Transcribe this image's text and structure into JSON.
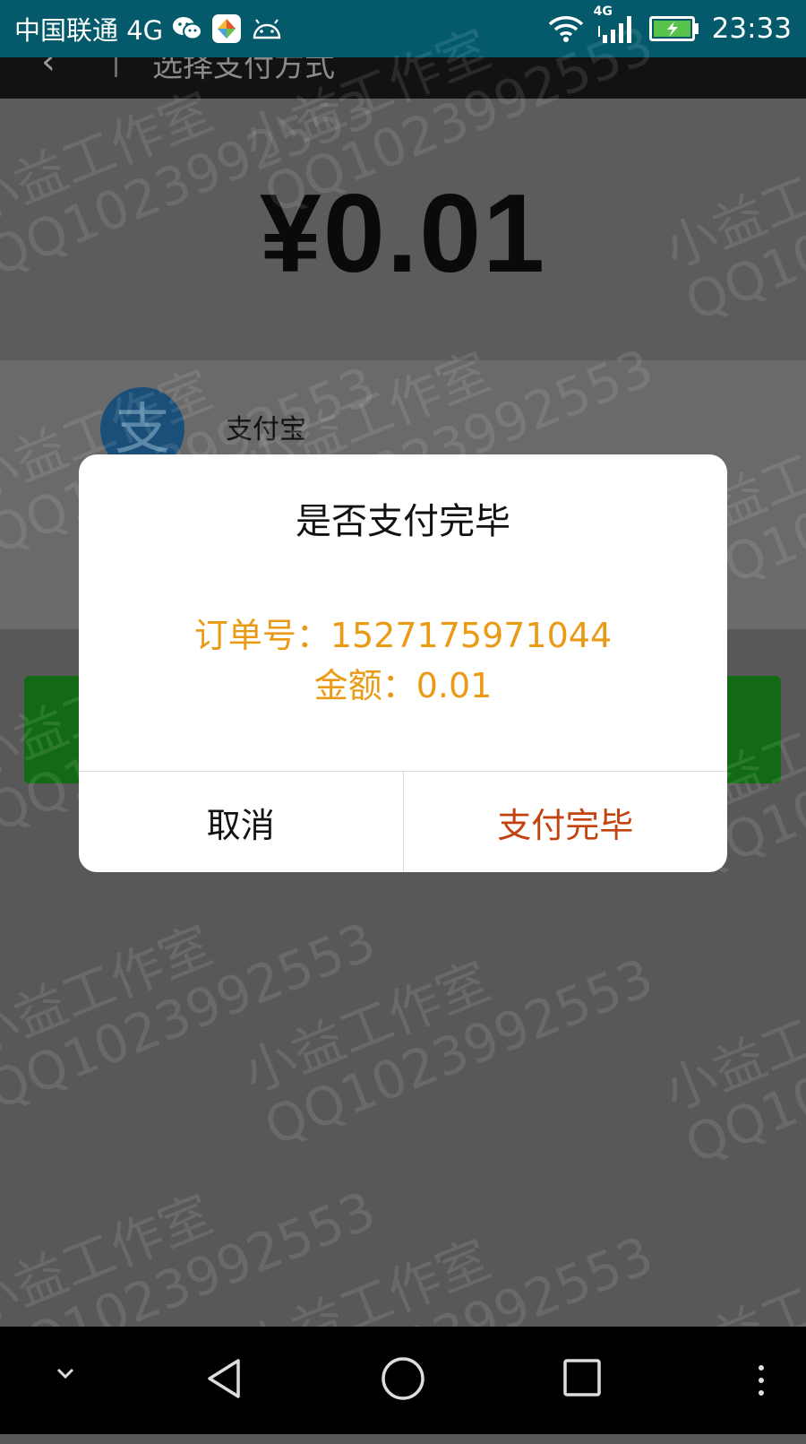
{
  "status_bar": {
    "carrier": "中国联通 4G",
    "network_badge": "4G",
    "time": "23:33",
    "icons": [
      "wechat-icon",
      "app-store-icon",
      "android-icon",
      "wifi-icon",
      "signal-icon",
      "battery-charging-icon"
    ]
  },
  "page": {
    "title": "选择支付方式",
    "amount": "¥0.01",
    "payment_method": "支付宝"
  },
  "dialog": {
    "title": "是否支付完毕",
    "order_line": "订单号：1527175971044",
    "amount_line": "金额：0.01",
    "cancel_label": "取消",
    "confirm_label": "支付完毕"
  },
  "watermark": {
    "line1": "小益工作室",
    "line2": "QQ1023992553"
  },
  "nav_bar": {
    "icons": [
      "chevron-down-icon",
      "back-triangle-icon",
      "home-circle-icon",
      "recents-square-icon",
      "more-dots-icon"
    ]
  },
  "colors": {
    "status_bar": "#045a6b",
    "dialog_info": "#eb9a16",
    "confirm": "#c2430e",
    "pay_button": "#136a14"
  }
}
